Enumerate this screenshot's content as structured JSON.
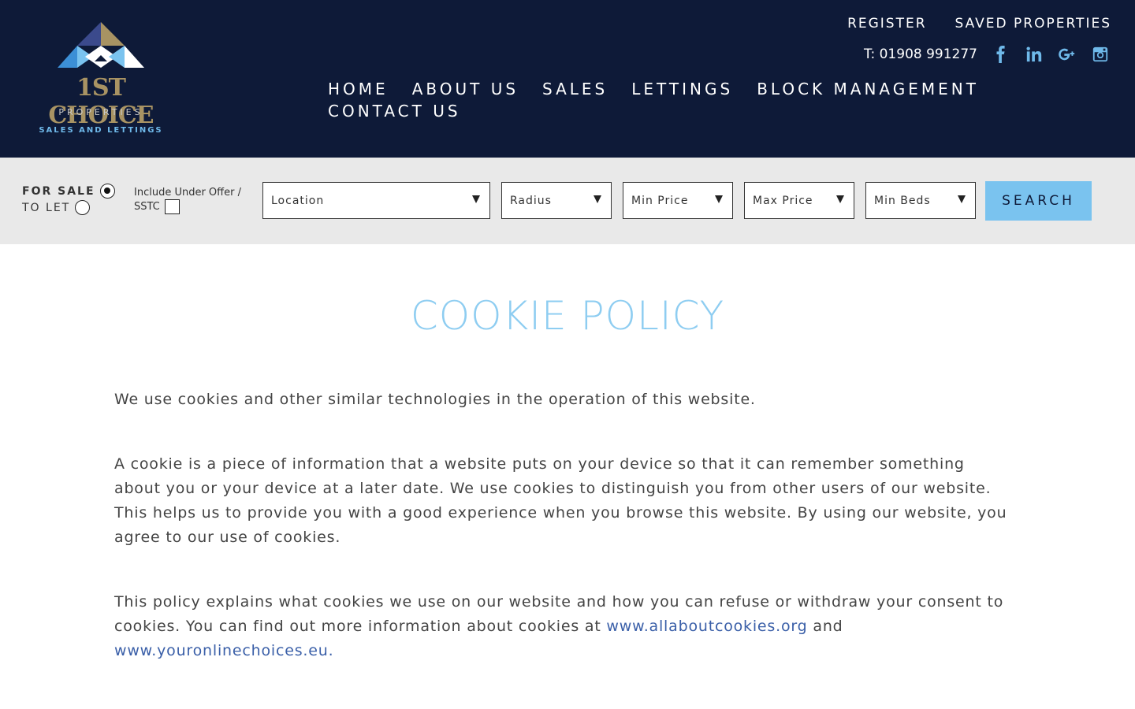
{
  "brand": {
    "name": "1ST CHOICE",
    "subtitle": "PROPERTIES",
    "tagline": "SALES AND LETTINGS"
  },
  "top_links": [
    {
      "label": "REGISTER"
    },
    {
      "label": "SAVED PROPERTIES"
    }
  ],
  "contact": {
    "phone": "T: 01908 991277"
  },
  "social_icons": [
    "facebook-icon",
    "linkedin-icon",
    "google-plus-icon",
    "instagram-icon"
  ],
  "nav": [
    {
      "label": "HOME"
    },
    {
      "label": "ABOUT US"
    },
    {
      "label": "SALES"
    },
    {
      "label": "LETTINGS"
    },
    {
      "label": "BLOCK MANAGEMENT"
    },
    {
      "label": "CONTACT US"
    }
  ],
  "search": {
    "for_sale_label": "FOR SALE",
    "to_let_label": "TO LET",
    "selected_mode": "FOR SALE",
    "include_offer_label": "Include Under Offer / SSTC",
    "include_offer_checked": false,
    "location": "Location",
    "radius": "Radius",
    "min_price": "Min Price",
    "max_price": "Max Price",
    "min_beds": "Min Beds",
    "button_label": "SEARCH"
  },
  "page": {
    "title": "COOKIE POLICY",
    "para1": "We use cookies and other similar technologies in the operation of this website.",
    "para2": "A cookie is a piece of information that a website puts on your device so that it can remember something about you or your device at a later date. We use cookies to distinguish you from other users of our website. This helps us to provide you with a good experience when you browse this website. By using our website, you agree to our use of cookies.",
    "para3_start": "This policy explains what cookies we use on our website and how you can refuse or withdraw your consent to cookies. You can find out more information about cookies at ",
    "link1": "www.allaboutcookies.org",
    "para3_mid": " and ",
    "link2": "www.youronlinechoices.eu",
    "para3_end": "."
  },
  "colors": {
    "header_bg": "#0e1a38",
    "accent_blue": "#7ac3ef",
    "brand_gold": "#a89363",
    "link_blue": "#3a5fa8"
  }
}
